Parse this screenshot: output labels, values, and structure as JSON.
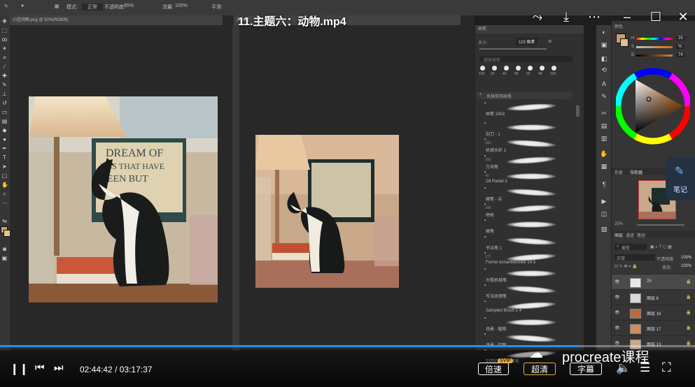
{
  "player": {
    "title": "11.主题六：动物.mp4",
    "current_time": "02:44:42",
    "separator": "/",
    "duration": "03:17:37",
    "progress": 0.833,
    "speed_label": "倍速",
    "svip_badge": "SVIP",
    "quality_label": "超清",
    "subtitle_label": "字幕",
    "watermark": "procreate课程",
    "notes_label": "笔记"
  },
  "ps": {
    "tab_left": "小区间图.png @ 50%(RGB/8)",
    "tab_right": "未标题",
    "options": {
      "mode_label": "模式:",
      "mode_value": "正常",
      "opacity_label": "不透明度:",
      "opacity_value": "95%",
      "flow_label": "流量:",
      "flow_value": "100%",
      "smooth_label": "平滑:"
    },
    "brush_panel": {
      "header": "画笔",
      "size_label": "大小:",
      "size_value": "119 像素",
      "search_placeholder": "搜索画笔",
      "presets": [
        "103",
        "22",
        "42",
        "85",
        "25",
        "48",
        "100"
      ],
      "folder_label": "风格常用画笔",
      "brushes": [
        {
          "num": "",
          "name": "画笔 2403"
        },
        {
          "num": "",
          "name": "刮刀 - 1"
        },
        {
          "num": "350",
          "name": "机械水彩 1"
        },
        {
          "num": "300",
          "name": "方块笔"
        },
        {
          "num": "40",
          "name": "Oil Pastel 3"
        },
        {
          "num": "",
          "name": "硬笔 - 尖"
        },
        {
          "num": "398",
          "name": "喷枪"
        },
        {
          "num": "",
          "name": "硬笔"
        },
        {
          "num": "",
          "name": "书法笔 1"
        },
        {
          "num": "173",
          "name": "Forme échantillonnée 14 5"
        },
        {
          "num": "",
          "name": "大粗机械笔"
        },
        {
          "num": "",
          "name": "写法纹理笔"
        },
        {
          "num": "",
          "name": "Sampled Brush 1 4"
        },
        {
          "num": "",
          "name": "场景 - 植物"
        },
        {
          "num": "",
          "name": "场景 - 起图"
        },
        {
          "num": "",
          "name": "刮用的综合刷面板"
        }
      ]
    },
    "color_panel": {
      "header": "颜色",
      "h_label": "H",
      "h_value": "25",
      "s_label": "S",
      "s_value": "%",
      "b_label": "B",
      "b_value": "74"
    },
    "navigator": {
      "tab_1": "色板",
      "tab_2": "导航器",
      "zoom": "25%"
    },
    "layers": {
      "tab_1": "图层",
      "tab_2": "通道",
      "tab_3": "路径",
      "kind_label": "类型",
      "blend": "正常",
      "opacity_label": "不透明度:",
      "opacity_value": "100%",
      "fill_label": "填充:",
      "fill_value": "100%",
      "rows": [
        {
          "name": "25"
        },
        {
          "name": "图层 6"
        },
        {
          "name": "图层 16"
        },
        {
          "name": "图层 17"
        },
        {
          "name": "图层 13"
        }
      ]
    }
  },
  "colors": {
    "accent": "#2a8cf0",
    "svip": "#e8b04a"
  }
}
